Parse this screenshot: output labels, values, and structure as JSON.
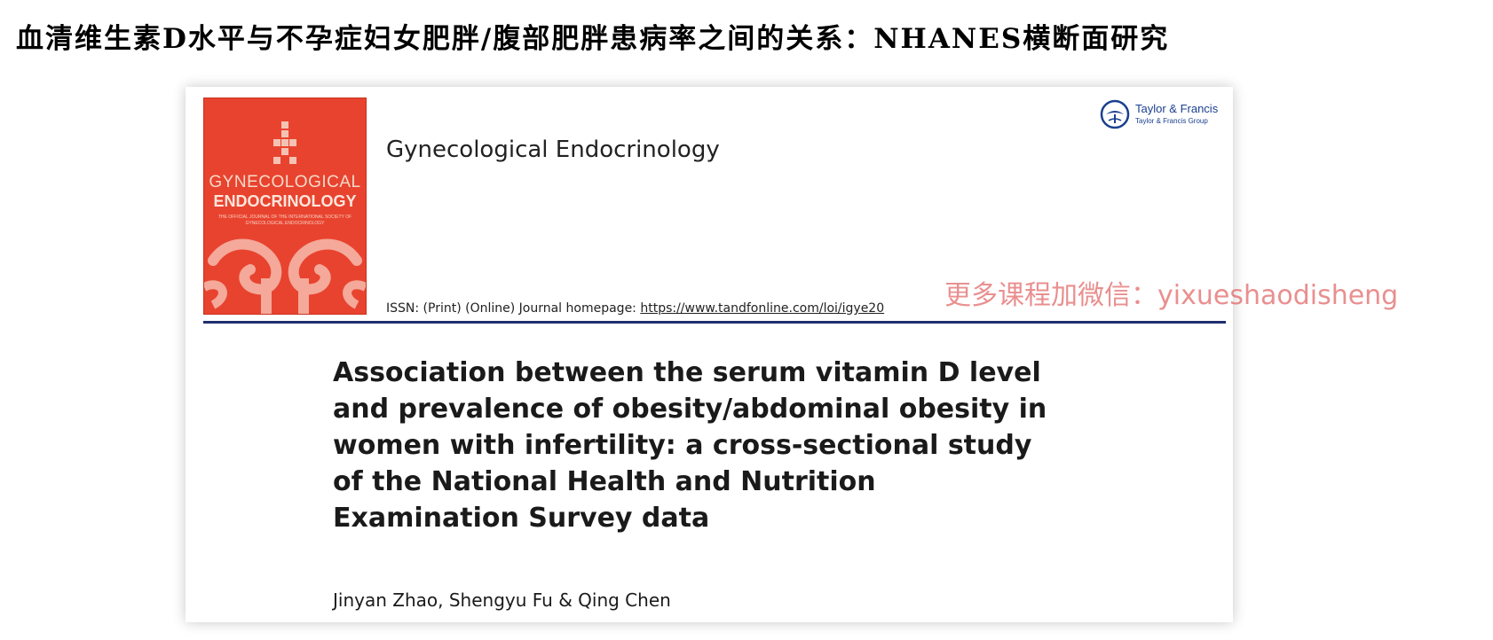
{
  "slide": {
    "title": "血清维生素D水平与不孕症妇女肥胖/腹部肥胖患病率之间的关系：NHANES横断面研究"
  },
  "journal": {
    "name": "Gynecological Endocrinology",
    "cover": {
      "line1": "GYNECOLOGICAL",
      "line2": "ENDOCRINOLOGY",
      "line3": "THE OFFICIAL JOURNAL OF THE INTERNATIONAL SOCIETY OF GYNECOLOGICAL ENDOCRINOLOGY",
      "color": "#e8432f"
    },
    "publisher": {
      "name": "Taylor & Francis",
      "group": "Taylor & Francis Group",
      "icon": "publisher-logo-icon",
      "color": "#1b3f8f"
    },
    "issn_prefix": "ISSN: (Print) (Online) Journal homepage: ",
    "homepage_url": "https://www.tandfonline.com/loi/igye20"
  },
  "article": {
    "title": "Association between the serum vitamin D level and prevalence of obesity/abdominal obesity in women with infertility: a cross-sectional study of the National Health and Nutrition Examination Survey data",
    "authors": "Jinyan Zhao, Shengyu Fu & Qing Chen"
  },
  "watermark": {
    "text": "更多课程加微信：yixueshaodisheng",
    "color": "#e06060"
  }
}
